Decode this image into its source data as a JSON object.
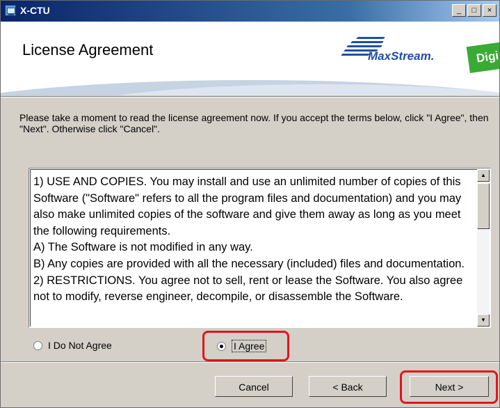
{
  "window": {
    "title": "X-CTU",
    "controls": {
      "minimize": "_",
      "maximize": "□",
      "close": "×"
    }
  },
  "banner": {
    "heading": "License Agreement",
    "brand_text": "MaxStream.",
    "digi_text": "Digi"
  },
  "intro_text": "Please take a moment to read the license agreement now. If you accept the terms below, click \"I Agree\", then \"Next\". Otherwise click \"Cancel\".",
  "license": {
    "lines": [
      "1) USE AND COPIES. You may install and use an unlimited number of copies of this Software (\"Software\" refers to all the program files and documentation) and you may also make unlimited copies of the software and give them away as long as you meet the following requirements.",
      "A) The Software is not modified in any way.",
      "B) Any copies are provided with all the necessary (included) files and documentation.",
      "2) RESTRICTIONS. You agree not to sell, rent or lease the Software.  You also agree not to modify, reverse engineer, decompile, or disassemble the Software."
    ],
    "scroll_up": "▲",
    "scroll_down": "▼"
  },
  "options": {
    "disagree_label": "I Do Not Agree",
    "agree_label": "I Agree",
    "selected": "agree"
  },
  "buttons": {
    "cancel": "Cancel",
    "back": "< Back",
    "next": "Next >"
  },
  "colors": {
    "highlight": "#e0161d",
    "titlebar": "#0a246a",
    "face": "#d4d0c8"
  }
}
